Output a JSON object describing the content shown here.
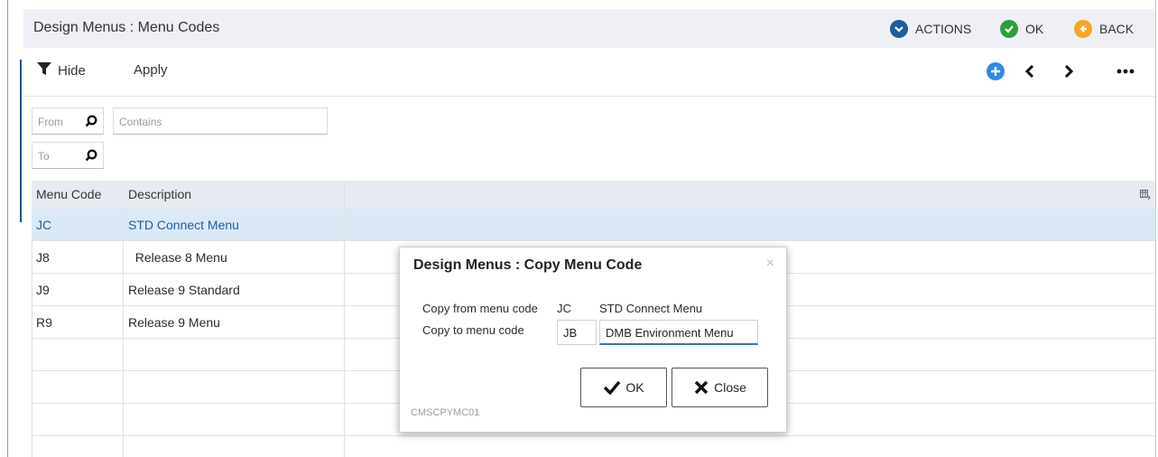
{
  "header": {
    "title": "Design Menus : Menu Codes",
    "actions_label": "ACTIONS",
    "ok_label": "OK",
    "back_label": "BACK"
  },
  "toolbar": {
    "hide_label": "Hide",
    "apply_label": "Apply"
  },
  "filters": {
    "from_placeholder": "From",
    "to_placeholder": "To",
    "contains_placeholder": "Contains"
  },
  "table": {
    "columns": [
      "Menu Code",
      "Description"
    ],
    "rows": [
      {
        "code": "JC",
        "description": "STD Connect Menu"
      },
      {
        "code": "J8",
        "description": "  Release 8 Menu"
      },
      {
        "code": "J9",
        "description": "Release 9 Standard"
      },
      {
        "code": "R9",
        "description": "Release 9 Menu"
      }
    ]
  },
  "dialog": {
    "title": "Design Menus : Copy Menu Code",
    "close_glyph": "×",
    "copy_from_label": "Copy from menu code",
    "copy_from_code": "JC",
    "copy_from_description": "STD Connect Menu",
    "copy_to_label": "Copy to menu code",
    "copy_to_code": "JB",
    "copy_to_description": "DMB Environment Menu",
    "ok_label": "OK",
    "close_label": "Close",
    "program_code": "CMSCPYMC01"
  },
  "colors": {
    "accent_blue": "#1f5c99",
    "ok_green": "#2e9e3a",
    "back_orange": "#f5a623",
    "add_blue": "#2d8ae0",
    "selected_row": "#dbe9f6"
  },
  "icons": [
    "chevron-down-circle-icon",
    "check-circle-icon",
    "back-arrow-circle-icon",
    "filter-icon",
    "add-circle-icon",
    "chevron-left-icon",
    "chevron-right-icon",
    "more-icon",
    "search-icon",
    "column-chooser-icon",
    "checkmark-icon",
    "close-x-icon"
  ]
}
